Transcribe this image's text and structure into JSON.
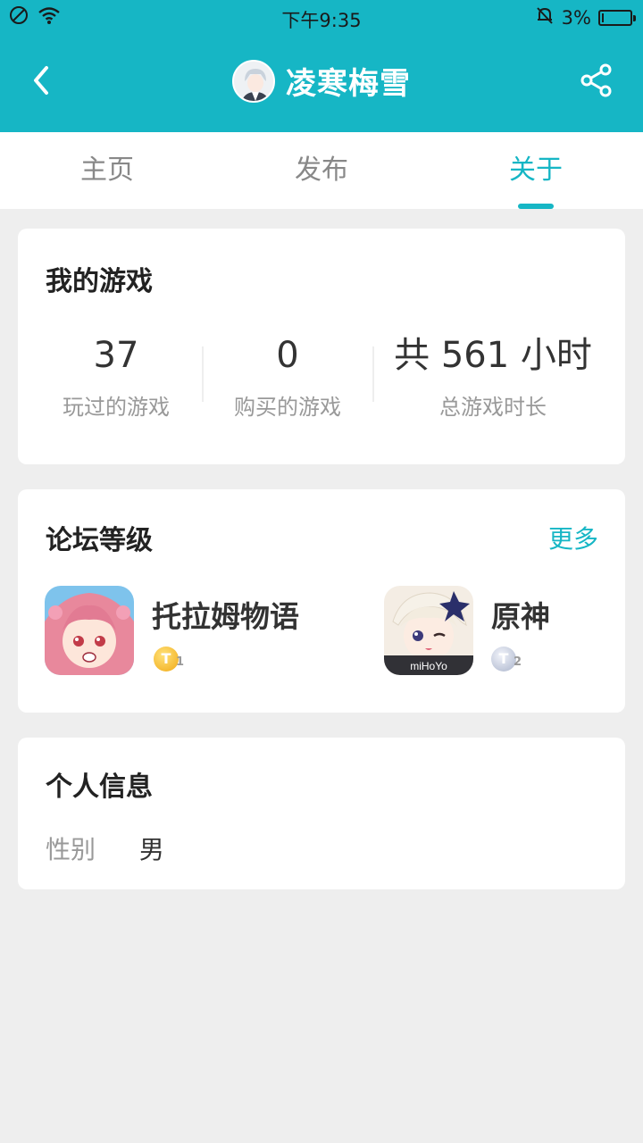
{
  "status_bar": {
    "time": "下午9:35",
    "battery": "3%"
  },
  "header": {
    "title": "凌寒梅雪",
    "icons": [
      "back-icon",
      "share-icon",
      "avatar"
    ]
  },
  "tabs": [
    {
      "label": "主页",
      "active": false
    },
    {
      "label": "发布",
      "active": false
    },
    {
      "label": "关于",
      "active": true
    }
  ],
  "my_games": {
    "title": "我的游戏",
    "stats": [
      {
        "value": "37",
        "label": "玩过的游戏"
      },
      {
        "value": "0",
        "label": "购买的游戏"
      },
      {
        "value": "共 561 小时",
        "label": "总游戏时长"
      }
    ]
  },
  "forum_level": {
    "title": "论坛等级",
    "more": "更多",
    "games": [
      {
        "name": "托拉姆物语",
        "level": "T",
        "sub": "1",
        "badge_color": "#f1a915"
      },
      {
        "name": "原神",
        "level": "T",
        "sub": "2",
        "badge_color": "#aab4cb",
        "icon_text": "miHoYo"
      }
    ]
  },
  "personal_info": {
    "title": "个人信息",
    "gender_label": "性别",
    "gender_value": "男"
  },
  "colors": {
    "accent": "#16b6c5",
    "background": "#eeeeee"
  }
}
